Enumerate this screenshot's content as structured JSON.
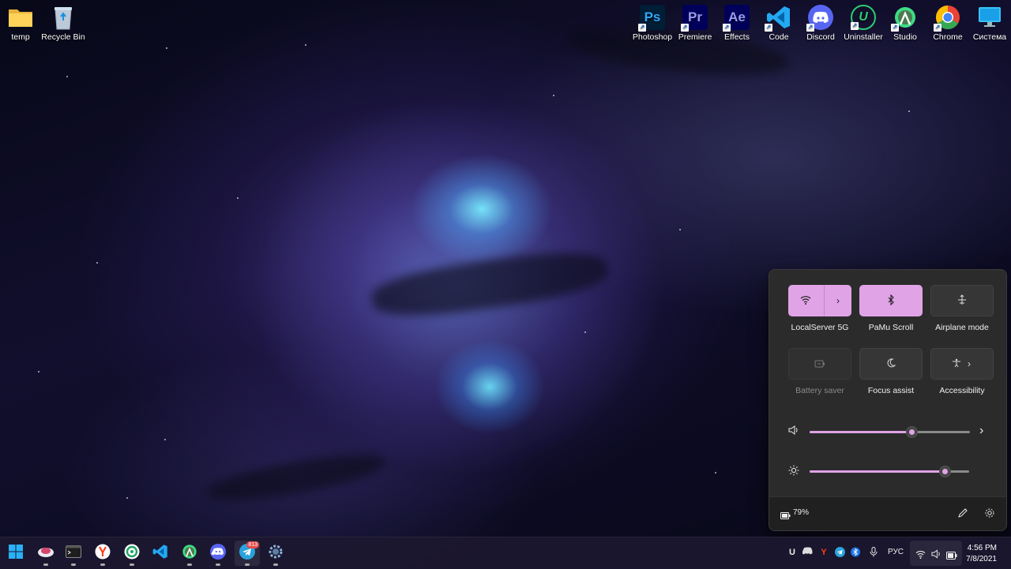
{
  "desktop": {
    "left_icons": [
      {
        "label": "temp",
        "icon": "folder-icon"
      },
      {
        "label": "Recycle Bin",
        "icon": "recycle-bin-icon"
      }
    ],
    "right_icons": [
      {
        "label": "Photoshop",
        "glyph": "Ps",
        "color": "#001e36",
        "accent": "#31a8ff"
      },
      {
        "label": "Premiere",
        "glyph": "Pr",
        "color": "#00005b",
        "accent": "#9999ff"
      },
      {
        "label": "Effects",
        "glyph": "Ae",
        "color": "#00005b",
        "accent": "#9999ff"
      },
      {
        "label": "Code",
        "glyph": "",
        "color": "#0065a9",
        "accent": "#23a9f2"
      },
      {
        "label": "Discord",
        "glyph": "",
        "color": "#5865f2",
        "accent": "#ffffff"
      },
      {
        "label": "Uninstaller",
        "glyph": "U",
        "color": "#0b3b2a",
        "accent": "#2ecc71"
      },
      {
        "label": "Studio",
        "glyph": "",
        "color": "#3ddc84",
        "accent": "#ffffff"
      },
      {
        "label": "Chrome",
        "glyph": "",
        "color": "#ffffff",
        "accent": "#ea4335"
      },
      {
        "label": "Система",
        "glyph": "",
        "color": "#1aa0e8",
        "accent": "#ffffff"
      }
    ]
  },
  "quick_settings": {
    "tiles": [
      {
        "label": "LocalServer 5G",
        "icon": "wifi-icon",
        "state": "on",
        "expand": true
      },
      {
        "label": "PaMu Scroll",
        "icon": "bluetooth-icon",
        "state": "on",
        "expand": false
      },
      {
        "label": "Airplane mode",
        "icon": "airplane-icon",
        "state": "off",
        "expand": false
      },
      {
        "label": "Battery saver",
        "icon": "battery-saver-icon",
        "state": "disabled",
        "expand": false
      },
      {
        "label": "Focus assist",
        "icon": "moon-icon",
        "state": "off",
        "expand": false
      },
      {
        "label": "Accessibility",
        "icon": "accessibility-icon",
        "state": "off",
        "expand": true
      }
    ],
    "volume": {
      "icon": "speaker-icon",
      "level": 0.64
    },
    "brightness": {
      "icon": "sun-icon",
      "level": 0.85
    },
    "battery_text": "79%",
    "accent_color": "#e0a3e6"
  },
  "taskbar": {
    "apps": [
      {
        "name": "start-button",
        "icon": "windows-icon"
      },
      {
        "name": "taskbar-app-1",
        "icon": "cloud-app-icon"
      },
      {
        "name": "taskbar-terminal",
        "icon": "terminal-icon"
      },
      {
        "name": "taskbar-yandex",
        "icon": "yandex-browser-icon"
      },
      {
        "name": "taskbar-app-4",
        "icon": "green-app-icon"
      },
      {
        "name": "taskbar-vscode",
        "icon": "vscode-icon"
      },
      {
        "name": "taskbar-android-studio",
        "icon": "android-studio-icon"
      },
      {
        "name": "taskbar-discord",
        "icon": "discord-icon"
      },
      {
        "name": "taskbar-telegram",
        "icon": "telegram-icon",
        "badge": "813"
      },
      {
        "name": "taskbar-settings",
        "icon": "gear-icon"
      }
    ],
    "tray": {
      "language": "РУС",
      "time": "4:56 PM",
      "date": "7/8/2021"
    }
  }
}
